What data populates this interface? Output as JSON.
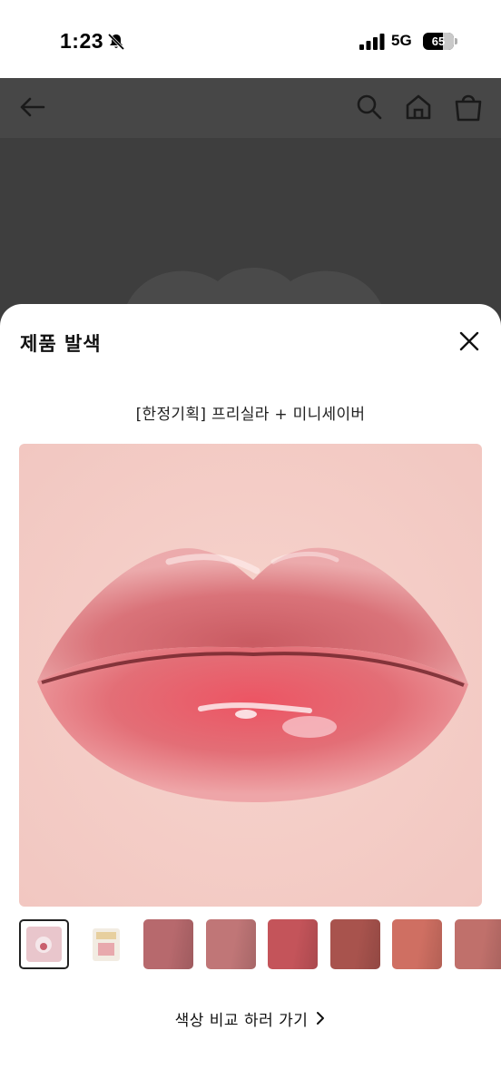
{
  "status_bar": {
    "time": "1:23",
    "network": "5G",
    "battery_level": "65",
    "icons": [
      "bell-slash-icon",
      "signal-bars-icon",
      "battery-icon"
    ]
  },
  "header": {
    "icons": [
      "back-arrow-icon",
      "search-icon",
      "home-icon",
      "shopping-bag-icon"
    ]
  },
  "sheet": {
    "title": "제품 발색",
    "close_icon": "close-icon",
    "product_name": "[한정기획] 프리실라 + 미니세이버",
    "thumbnails": [
      {
        "kind": "product-box",
        "color": "#e9c6cc",
        "selected": true
      },
      {
        "kind": "product-package",
        "color": "#f2ece2",
        "selected": false
      },
      {
        "kind": "swatch",
        "color": "#b7696d",
        "selected": false
      },
      {
        "kind": "swatch",
        "color": "#c07677",
        "selected": false
      },
      {
        "kind": "swatch",
        "color": "#c4545a",
        "selected": false
      },
      {
        "kind": "swatch",
        "color": "#a8534d",
        "selected": false
      },
      {
        "kind": "swatch",
        "color": "#cf6f62",
        "selected": false
      },
      {
        "kind": "swatch",
        "color": "#c0706b",
        "selected": false
      }
    ],
    "compare_label": "색상 비교 하러 가기",
    "compare_icon": "chevron-right-icon"
  }
}
